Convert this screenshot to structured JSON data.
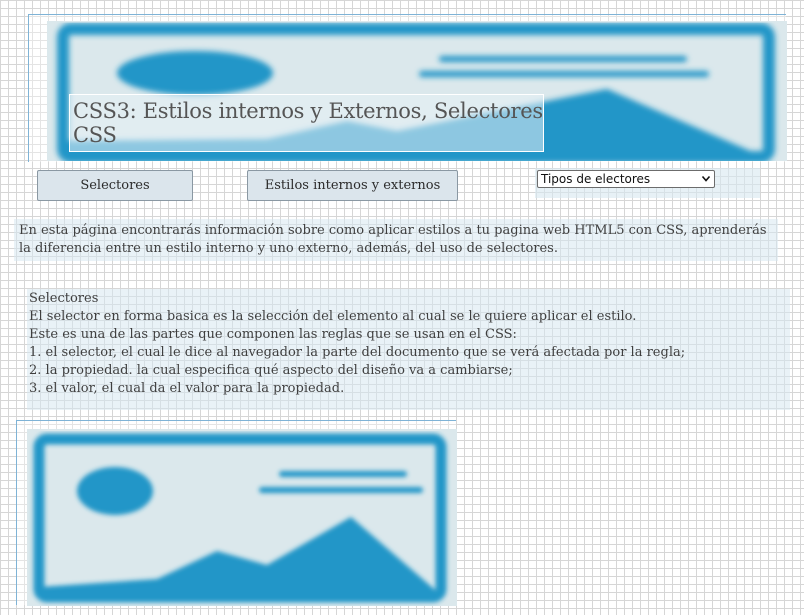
{
  "header": {
    "title": "CSS3: Estilos internos y Externos, Selectores CSS",
    "banner_image_icon": "image-placeholder-icon"
  },
  "nav": {
    "buttons": [
      {
        "label": "Selectores"
      },
      {
        "label": "Estilos internos y externos"
      }
    ],
    "select": {
      "selected": "Tipos de electores",
      "icon": "chevron-down-icon"
    }
  },
  "intro": {
    "text": "En esta página encontrarás información sobre como aplicar estilos a tu pagina web HTML5 con CSS, aprenderás la diferencia entre un estilo interno y uno externo, además, del uso de selectores."
  },
  "selectores": {
    "heading": "Selectores",
    "lines": [
      "El selector en forma basica es la selección del elemento al cual se le quiere aplicar el estilo.",
      "Este es una de las partes que componen las reglas que se usan en el CSS:",
      "1. el selector, el cual le dice al navegador la parte del documento que se verá afectada por la regla;",
      "2. la propiedad. la cual especifica qué aspecto del diseño va a cambiarse;",
      "3. el valor, el cual da el valor para la propiedad."
    ]
  },
  "figure": {
    "icon": "image-placeholder-icon"
  },
  "colors": {
    "placeholder_blue": "#2196c8",
    "placeholder_bg": "#dbe8ec",
    "panel_bg": "#d7e8f0",
    "button_bg": "#dbe5ec"
  }
}
